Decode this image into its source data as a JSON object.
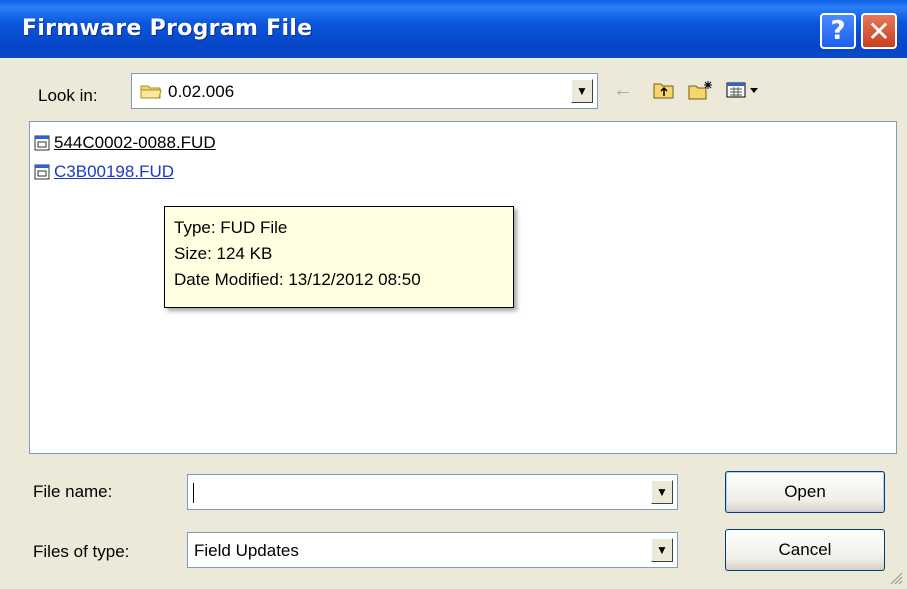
{
  "window": {
    "title": "Firmware Program File"
  },
  "titlebar": {
    "help_glyph": "?",
    "close_glyph": "✕"
  },
  "toolbar": {
    "look_in_label": "Look in:",
    "look_in_value": "0.02.006",
    "icons": [
      "back-arrow-icon",
      "up-one-level-icon",
      "new-folder-icon",
      "view-menu-icon"
    ]
  },
  "files": [
    {
      "name": "544C0002-0088.FUD",
      "hot": false
    },
    {
      "name": "C3B00198.FUD",
      "hot": true
    }
  ],
  "tooltip": {
    "type": "Type: FUD File",
    "size": "Size: 124 KB",
    "modified": "Date Modified: 13/12/2012 08:50"
  },
  "form": {
    "file_name_label": "File name:",
    "file_name_value": "",
    "files_of_type_label": "Files of type:",
    "files_of_type_value": "Field Updates",
    "open_label": "Open",
    "cancel_label": "Cancel"
  },
  "colors": {
    "titlebar": "#0a56dc",
    "dialog_bg": "#ece9d8",
    "tooltip_bg": "#ffffe1",
    "link_hot": "#1c38c8"
  }
}
